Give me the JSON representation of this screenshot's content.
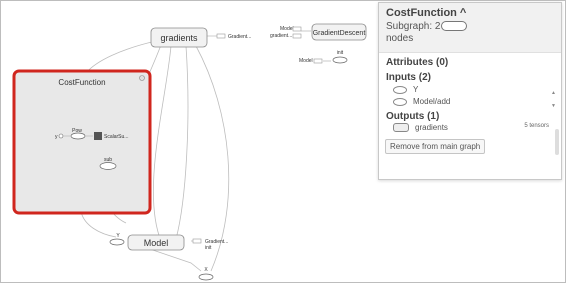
{
  "graph": {
    "nodes": {
      "gradients": "gradients",
      "cost_function": "CostFunction",
      "gradient_descent": "GradientDescent",
      "model": "Model",
      "init": "init",
      "pow": "Pow",
      "sub": "sub",
      "y_input": "Y",
      "x_input": "X",
      "y_small": "y",
      "scalar_summary": "ScalarSu..."
    },
    "side_labels": {
      "gradients_out": "Gradient...",
      "gd_model": "Model",
      "gd_gradients": "gradient...",
      "init_model": "Model",
      "model_gradient": "Gradient...",
      "model_init": "init"
    }
  },
  "panel": {
    "title": "CostFunction",
    "collapse_glyph": "^",
    "subgraph_label": "Subgraph: 2",
    "nodes_word": "nodes",
    "attributes_title": "Attributes (0)",
    "inputs_title": "Inputs (2)",
    "inputs": [
      "Y",
      "Model/add"
    ],
    "outputs_title": "Outputs (1)",
    "outputs": [
      "gradients"
    ],
    "outputs_tensor_count": "5 tensors",
    "remove_button": "Remove from main graph"
  }
}
